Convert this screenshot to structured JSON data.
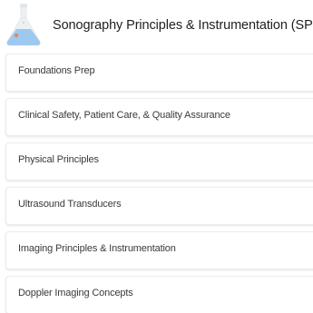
{
  "header": {
    "icon": "flask-icon",
    "title": "Sonography Principles & Instrumentation (SPI)"
  },
  "colors": {
    "flask_liquid": "#9ec9ef",
    "flask_glass": "#eef1f4",
    "flask_bubble": "#d98c6b"
  },
  "topics": [
    {
      "label": "Foundations Prep"
    },
    {
      "label": "Clinical Safety, Patient Care, & Quality Assurance"
    },
    {
      "label": "Physical Principles"
    },
    {
      "label": "Ultrasound Transducers"
    },
    {
      "label": "Imaging Principles & Instrumentation"
    },
    {
      "label": "Doppler Imaging Concepts"
    }
  ]
}
